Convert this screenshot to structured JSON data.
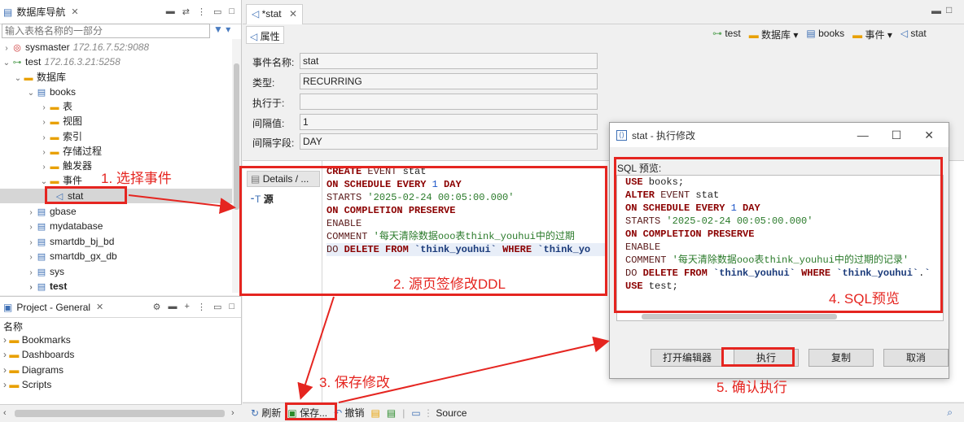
{
  "nav": {
    "title": "数据库导航",
    "filter_placeholder": "输入表格名称的一部分",
    "tree": [
      {
        "label": "sysmaster",
        "sub": "172.16.7.52:9088"
      },
      {
        "label": "test",
        "sub": "172.16.3.21:5258"
      },
      {
        "label": "数据库"
      },
      {
        "label": "books"
      },
      {
        "label": "表"
      },
      {
        "label": "视图"
      },
      {
        "label": "索引"
      },
      {
        "label": "存储过程"
      },
      {
        "label": "触发器"
      },
      {
        "label": "事件"
      },
      {
        "label": "stat"
      },
      {
        "label": "gbase"
      },
      {
        "label": "mydatabase"
      },
      {
        "label": "smartdb_bj_bd"
      },
      {
        "label": "smartdb_gx_db"
      },
      {
        "label": "sys"
      },
      {
        "label": "test"
      }
    ]
  },
  "project": {
    "title": "Project - General",
    "column": "名称",
    "items": [
      "Bookmarks",
      "Dashboards",
      "Diagrams",
      "Scripts"
    ]
  },
  "editor": {
    "tab": "*stat",
    "props_tab": "属性",
    "toolbar": [
      "test",
      "数据库",
      "books",
      "事件",
      "stat"
    ],
    "fields": [
      {
        "label": "事件名称:",
        "value": "stat"
      },
      {
        "label": "类型:",
        "value": "RECURRING"
      },
      {
        "label": "执行于:",
        "value": ""
      },
      {
        "label": "间隔值:",
        "value": "1"
      },
      {
        "label": "间隔字段:",
        "value": "DAY"
      }
    ],
    "details_tab": "Details / ...",
    "source_tab": "源",
    "sql_lines": [
      "CREATE EVENT stat",
      "ON SCHEDULE EVERY 1 DAY",
      "STARTS '2025-02-24 00:05:00.000'",
      "ON COMPLETION PRESERVE",
      "ENABLE",
      "COMMENT '每天清除数据ooo表think_youhui中的过期",
      "DO DELETE FROM `think_youhui` WHERE `think_yo"
    ],
    "bottom": {
      "refresh": "刷新",
      "save": "保存...",
      "undo": "撤销",
      "source": "Source"
    }
  },
  "dialog": {
    "title": "stat - 执行修改",
    "label": "SQL 预览:",
    "sql_lines": [
      "USE books;",
      "ALTER EVENT stat",
      "ON SCHEDULE EVERY 1 DAY",
      "STARTS '2025-02-24 00:05:00.000'",
      "ON COMPLETION PRESERVE",
      "ENABLE",
      "COMMENT '每天清除数据ooo表think_youhui中的过期的记录'",
      "DO DELETE FROM `think_youhui` WHERE `think_youhui`.`",
      "USE test;"
    ],
    "buttons": {
      "open": "打开编辑器",
      "execute": "执行",
      "copy": "复制",
      "cancel": "取消"
    }
  },
  "annotations": {
    "a1": "1. 选择事件",
    "a2": "2. 源页签修改DDL",
    "a3": "3. 保存修改",
    "a4": "4. SQL预览",
    "a5": "5. 确认执行"
  },
  "colors": {
    "accent_red": "#e52520"
  }
}
